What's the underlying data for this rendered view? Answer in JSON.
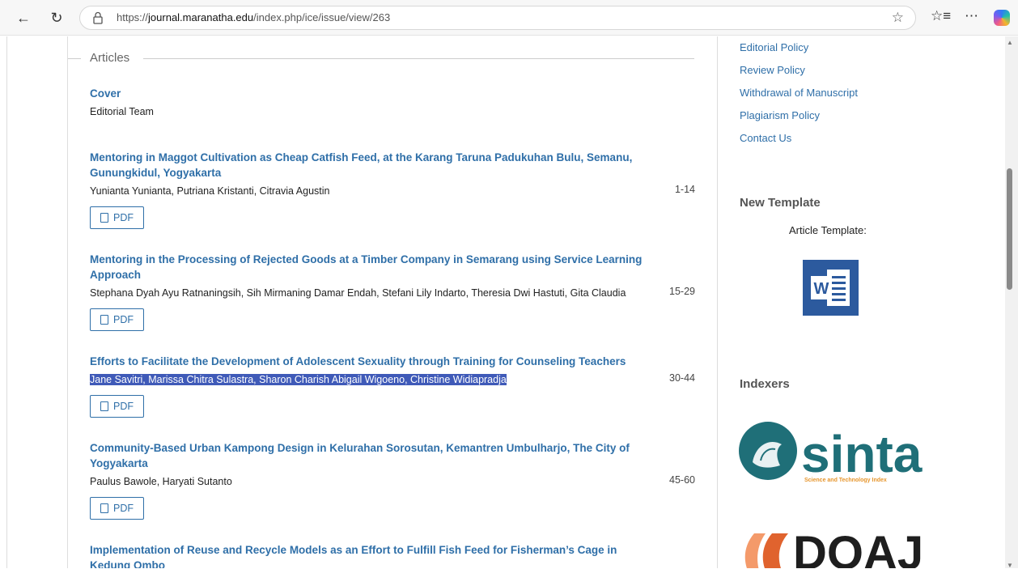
{
  "browser": {
    "url_prefix": "https://",
    "url_domain": "journal.maranatha.edu",
    "url_path": "/index.php/ice/issue/view/263"
  },
  "articles": {
    "heading": "Articles",
    "items": [
      {
        "title": "Cover",
        "authors": "Editorial Team",
        "pages": "",
        "pdf": ""
      },
      {
        "title": "Mentoring in Maggot Cultivation as Cheap Catfish Feed, at the Karang Taruna Padukuhan Bulu, Semanu, Gunungkidul, Yogyakarta",
        "authors": "Yunianta Yunianta, Putriana Kristanti, Citravia Agustin",
        "pages": "1-14",
        "pdf": "PDF"
      },
      {
        "title": "Mentoring in the Processing of Rejected Goods at a Timber Company in Semarang using Service Learning Approach",
        "authors": "Stephana Dyah Ayu Ratnaningsih, Sih Mirmaning Damar Endah, Stefani Lily Indarto, Theresia Dwi Hastuti, Gita Claudia",
        "pages": "15-29",
        "pdf": "PDF"
      },
      {
        "title": "Efforts to Facilitate the Development of Adolescent Sexuality through Training for Counseling Teachers",
        "authors": "Jane Savitri, Marissa Chitra Sulastra, Sharon Charish Abigail Wigoeno, Christine Widiapradja",
        "pages": "30-44",
        "pdf": "PDF"
      },
      {
        "title": "Community-Based Urban Kampong Design in Kelurahan Sorosutan, Kemantren Umbulharjo, The City of Yogyakarta",
        "authors": "Paulus Bawole, Haryati Sutanto",
        "pages": "45-60",
        "pdf": "PDF"
      },
      {
        "title": "Implementation of Reuse and Recycle Models as an Effort to Fulfill Fish Feed for Fisherman’s Cage in Kedung Ombo",
        "authors": "",
        "pages": "",
        "pdf": ""
      }
    ]
  },
  "sidebar": {
    "links": [
      "Editorial Policy",
      "Review Policy",
      "Withdrawal of Manuscript",
      "Plagiarism Policy",
      "Contact Us"
    ],
    "template_heading": "New Template",
    "template_label": "Article Template:",
    "word_letter": "W",
    "indexers_heading": "Indexers",
    "sinta_text": "sinta",
    "sinta_sub": "Science and Technology Index",
    "doaj_text": "DOAJ"
  },
  "colors": {
    "link": "#2f6fa8",
    "selection": "#3f5ab8",
    "sinta_teal": "#1f6f78",
    "doaj_orange": "#f07e4f"
  }
}
